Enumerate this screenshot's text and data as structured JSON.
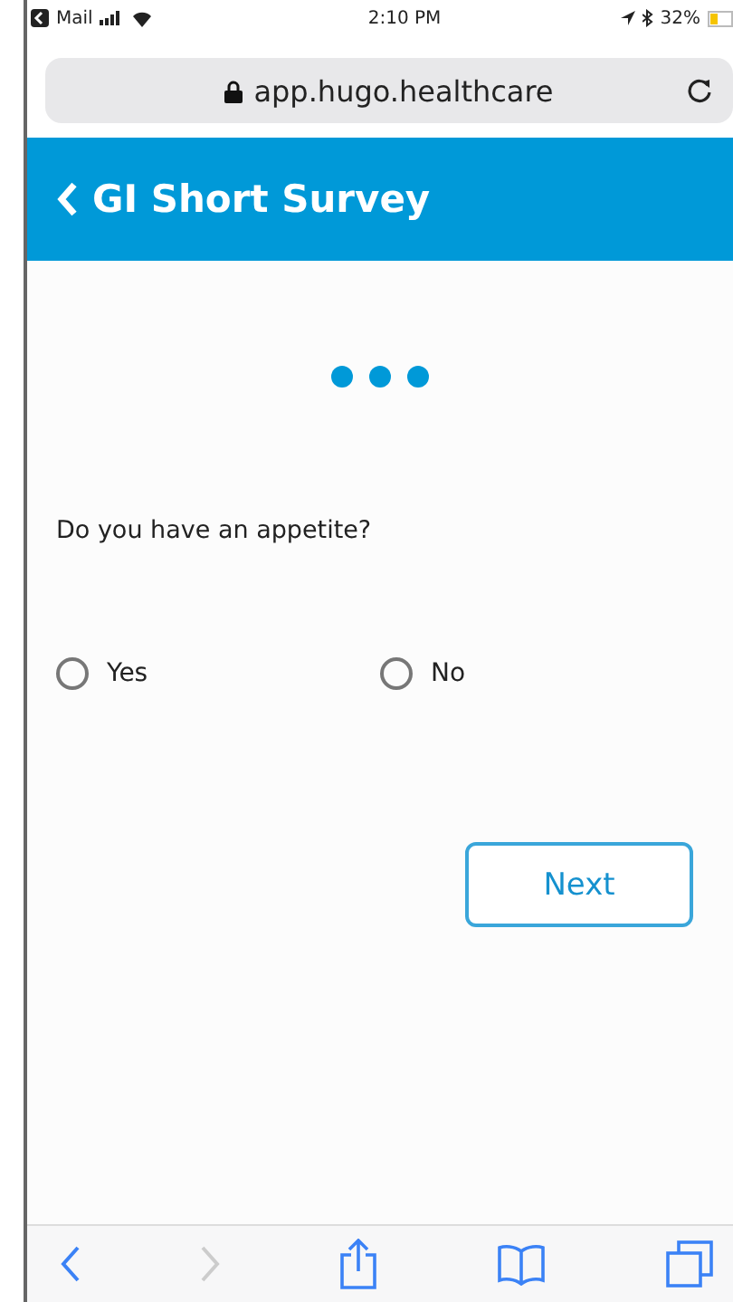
{
  "status_bar": {
    "back_app": "Mail",
    "time": "2:10 PM",
    "battery": "32%"
  },
  "address_bar": {
    "url": "app.hugo.healthcare"
  },
  "header": {
    "title": "GI Short Survey"
  },
  "question": {
    "text": "Do you have an appetite?",
    "options": [
      {
        "label": "Yes",
        "selected": false
      },
      {
        "label": "No",
        "selected": false
      }
    ]
  },
  "next_button": {
    "label": "Next"
  },
  "toolbar": {
    "back_disabled": false,
    "forward_disabled": true
  }
}
